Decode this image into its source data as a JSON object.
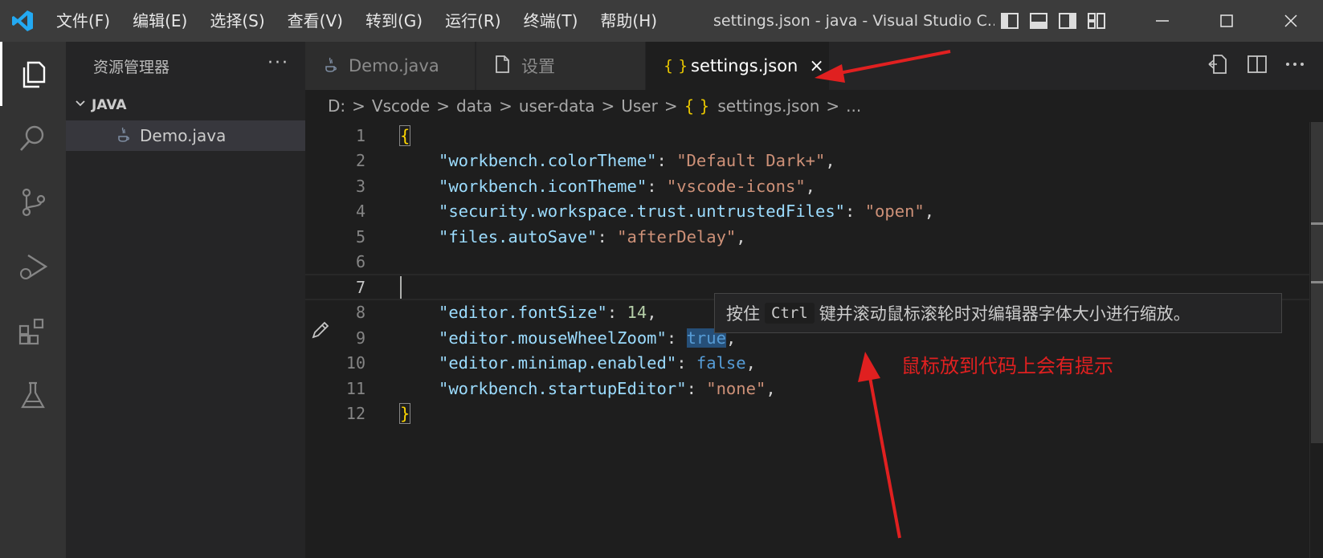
{
  "titlebar": {
    "menu": [
      "文件(F)",
      "编辑(E)",
      "选择(S)",
      "查看(V)",
      "转到(G)",
      "运行(R)",
      "终端(T)",
      "帮助(H)"
    ],
    "window_title": "settings.json - java - Visual Studio C..."
  },
  "sidebar": {
    "title": "资源管理器",
    "more": "···",
    "folder": "JAVA",
    "files": [
      "Demo.java"
    ]
  },
  "tabs": [
    {
      "label": "Demo.java",
      "icon": "java-icon",
      "active": false
    },
    {
      "label": "设置",
      "icon": "file-icon",
      "active": false
    },
    {
      "label": "settings.json",
      "icon": "json-braces-icon",
      "active": true,
      "close": "×"
    }
  ],
  "breadcrumb": [
    "D:",
    "Vscode",
    "data",
    "user-data",
    "User",
    "settings.json",
    "..."
  ],
  "breadcrumb_sep": ">",
  "braces_glyph": "{ }",
  "editor": {
    "line_numbers": [
      "1",
      "2",
      "3",
      "4",
      "5",
      "6",
      "7",
      "8",
      "9",
      "10",
      "11",
      "12"
    ],
    "lines": [
      {
        "key": "",
        "value": ""
      },
      {
        "key": "\"workbench.colorTheme\"",
        "value": "\"Default Dark+\""
      },
      {
        "key": "\"workbench.iconTheme\"",
        "value": "\"vscode-icons\""
      },
      {
        "key": "\"security.workspace.trust.untrustedFiles\"",
        "value": "\"open\""
      },
      {
        "key": "\"files.autoSave\"",
        "value": "\"afterDelay\""
      },
      {
        "key": "\"editor.fontSize\"",
        "value": "14"
      },
      {
        "key": "\"editor.mouseWheelZoom\"",
        "value": "true"
      },
      {
        "key": "\"editor.minimap.enabled\"",
        "value": "false"
      },
      {
        "key": "\"workbench.startupEditor\"",
        "value": "\"none\""
      }
    ],
    "open_brace": "{",
    "close_brace": "}",
    "colon": ": ",
    "comma": ","
  },
  "hover": {
    "before": "按住",
    "kbd": "Ctrl",
    "after": "键并滚动鼠标滚轮时对编辑器字体大小进行缩放。"
  },
  "annotation": "鼠标放到代码上会有提示",
  "colors": {
    "accent": "#007acc",
    "annotation_red": "#e02020",
    "string": "#ce9178",
    "key": "#9cdcfe"
  }
}
